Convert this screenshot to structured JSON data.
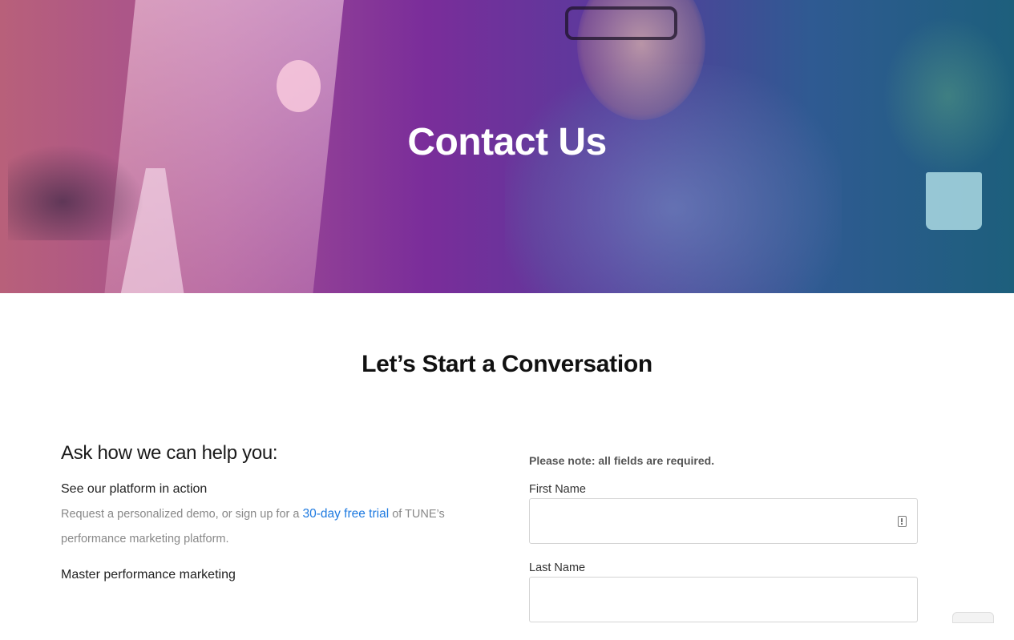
{
  "hero": {
    "title": "Contact Us"
  },
  "section": {
    "title": "Let’s Start a Conversation"
  },
  "help": {
    "heading": "Ask how we can help you:",
    "items": [
      {
        "title": "See our platform in action",
        "desc_before": "Request a personalized demo, or sign up for a ",
        "link": "30-day free trial",
        "desc_after": " of TUNE’s performance marketing platform."
      },
      {
        "title": "Master performance marketing"
      }
    ]
  },
  "form": {
    "note": "Please note: all fields are required.",
    "first_name_label": "First Name",
    "first_name_value": "",
    "last_name_label": "Last Name",
    "last_name_value": ""
  },
  "colors": {
    "link": "#1e7ae0",
    "hero_gradient_start": "#b8607a",
    "hero_gradient_end": "#1d5f7c"
  }
}
